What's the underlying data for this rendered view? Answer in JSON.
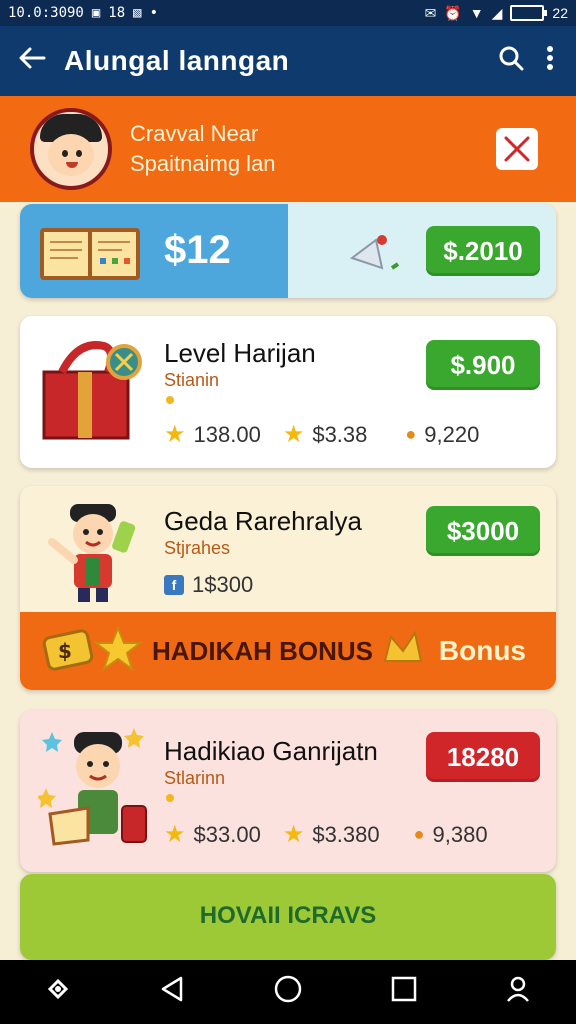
{
  "status_bar": {
    "time_left": "10.0:3090",
    "badges": [
      "18"
    ],
    "time_right": "22"
  },
  "app_bar": {
    "title": "Alungal lanngan",
    "back_icon": "arrow-left-icon",
    "search_icon": "search-icon",
    "menu_icon": "more-vert-icon"
  },
  "banner": {
    "line1": "Cravval Near",
    "line2": "Spaitnaimg lan",
    "close_icon": "close-icon"
  },
  "cards": [
    {
      "price": "$12",
      "button": "$.2010",
      "button_color": "#3aa82e"
    },
    {
      "title": "Level Harijan",
      "subtitle": "Stianin",
      "button": "$.900",
      "meta": [
        "138.00",
        "$3.38",
        "9,220"
      ]
    },
    {
      "title": "Geda Rarehralya",
      "subtitle": "Stjrahes",
      "button": "$3000",
      "meta": [
        "1$300"
      ],
      "bonus_text": "HADIKAH BONUS",
      "bonus_label": "Bonus"
    },
    {
      "title": "Hadikiao Ganrijatn",
      "subtitle": "Stlarinn",
      "button": "18280",
      "button_color": "#d0262a",
      "meta": [
        "$33.00",
        "$3.380",
        "9,380"
      ]
    },
    {
      "footer_text": "HOVAII ICRAVS"
    }
  ],
  "nav": {
    "items": [
      "recent-apps-alt-icon",
      "back-triangle-icon",
      "home-circle-icon",
      "overview-square-icon",
      "profile-icon"
    ]
  }
}
